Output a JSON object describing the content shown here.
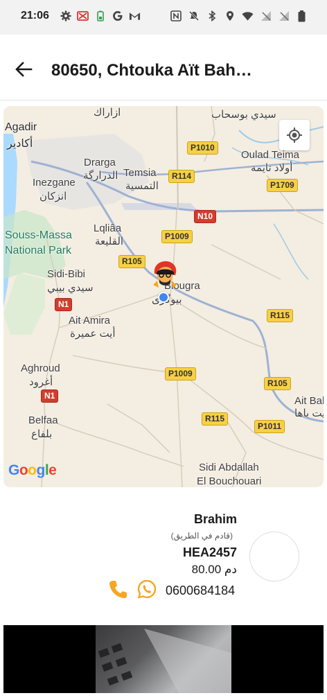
{
  "status_bar": {
    "time": "21:06",
    "left_icons": [
      "settings-icon",
      "crossed-app-icon",
      "battery-saver-icon",
      "google-icon",
      "gmail-icon"
    ],
    "right_icons": [
      "nfc-icon",
      "mute-icon",
      "bluetooth-icon",
      "location-icon",
      "wifi-icon",
      "no-signal-icon",
      "no-signal-icon",
      "battery-icon"
    ]
  },
  "header": {
    "title": "80650, Chtouka Aït Bah…"
  },
  "map": {
    "places": {
      "agadir": "Agadir",
      "agadir_ar": "أكادير",
      "izarak_ar": "ازاراك",
      "sidi_bousahab_ar": "سيدي بوسحاب",
      "oulad_teima": "Oulad Teima",
      "oulad_teima_ar": "أولاد تايمة",
      "drarga": "Drarga",
      "drarga_ar": "الدرارگة",
      "temsia": "Temsia",
      "temsia_ar": "التمسية",
      "inezgane": "Inezgane",
      "inezgane_ar": "انزكان",
      "park_1": "Souss-Massa",
      "park_2": "National Park",
      "lqliaa": "Lqliâa",
      "lqliaa_ar": "القليعة",
      "sidi_bibi": "Sidi-Bibi",
      "sidi_bibi_ar": "سيدي بيبي",
      "biougra": "Biougra",
      "biougra_ar": "بيوگرى",
      "ait_amira": "Ait Amira",
      "ait_amira_ar": "أيت عميرة",
      "aghroud": "Aghroud",
      "aghroud_ar": "أغرود",
      "belfaa": "Belfaa",
      "belfaa_ar": "بلفاع",
      "ait_baha": "Ait Bah",
      "ait_baha_ar": "أيت باها",
      "sidi_abdallah": "Sidi Abdallah",
      "el_bouchouari": "El Bouchouari"
    },
    "roads": {
      "p1010": "P1010",
      "r114": "R114",
      "p1709": "P1709",
      "n10": "N10",
      "p1009_top": "P1009",
      "r105_left": "R105",
      "n1_top": "N1",
      "r115_right": "R115",
      "p1009_bottom": "P1009",
      "r105_right": "R105",
      "n1_bottom": "N1",
      "r115_bottom": "R115",
      "p1011": "P1011"
    },
    "attribution": "Google",
    "colors": {
      "land": "#f4ede1",
      "water": "#aadaff",
      "park": "#c8e6c9",
      "urban": "#e8e6e3",
      "road_major": "#8ba3c9",
      "highway_shield": "#f7d046",
      "national_shield": "#d23d2e",
      "user_location": "#4285f4"
    }
  },
  "driver": {
    "name": "Brahim",
    "status": "(قادم في الطريق)",
    "plate": "HEA2457",
    "price": "80.00 دم",
    "phone": "0600684184",
    "call_icon": "phone-icon",
    "whatsapp_icon": "whatsapp-icon",
    "phone_color": "#f5a623",
    "whatsapp_color": "#f5a623"
  }
}
